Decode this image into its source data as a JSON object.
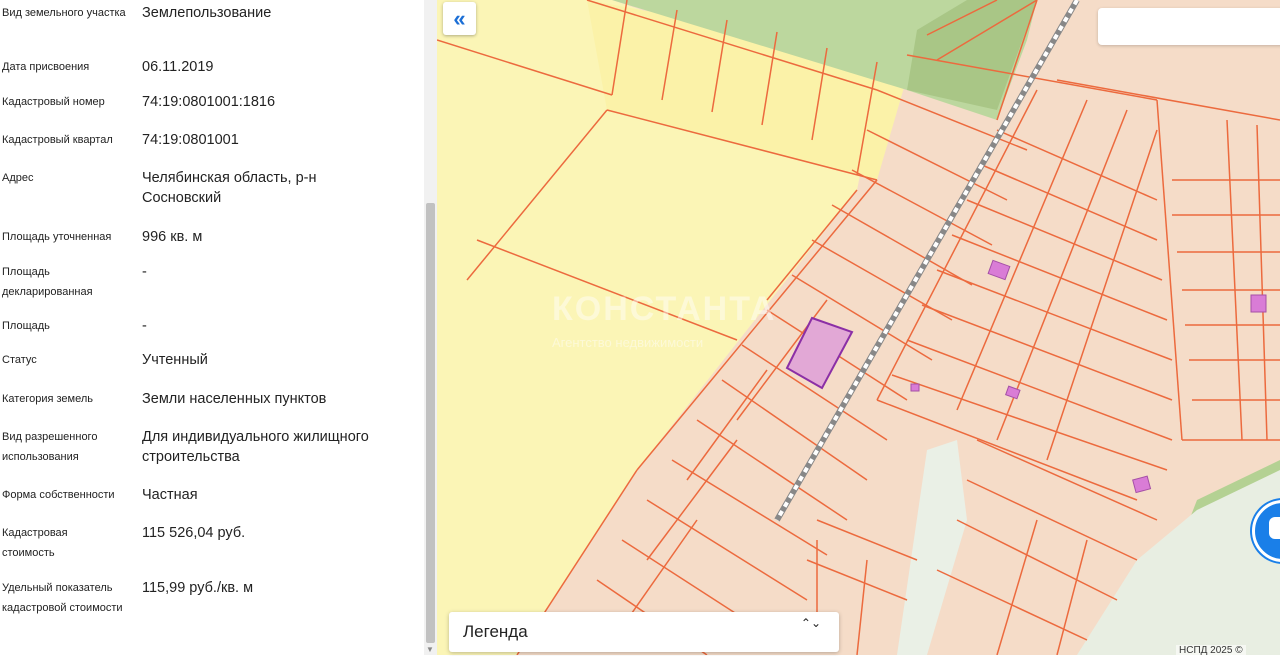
{
  "properties": [
    {
      "label": "Вид земельного участка",
      "value": "Землепользование"
    },
    {
      "label": "Дата присвоения",
      "value": "06.11.2019"
    },
    {
      "label": "Кадастровый номер",
      "value": "74:19:0801001:1816"
    },
    {
      "label": "Кадастровый квартал",
      "value": "74:19:0801001"
    },
    {
      "label": "Адрес",
      "value": "Челябинская область, р-н Сосновский"
    },
    {
      "label": "Площадь уточненная",
      "value": "996 кв. м"
    },
    {
      "label": "Площадь декларированная",
      "value": "-"
    },
    {
      "label": "Площадь",
      "value": "-"
    },
    {
      "label": "Статус",
      "value": "Учтенный"
    },
    {
      "label": "Категория земель",
      "value": "Земли населенных пунктов"
    },
    {
      "label": "Вид разрешенного использования",
      "value": "Для индивидуального жилищного строительства"
    },
    {
      "label": "Форма собственности",
      "value": "Частная"
    },
    {
      "label": "Кадастровая стоимость",
      "value": "115 526,04 руб."
    },
    {
      "label": "Удельный показатель кадастровой стоимости",
      "value": "115,99 руб./кв. м"
    }
  ],
  "map": {
    "collapse_icon": "«",
    "legend_label": "Легенда",
    "legend_arrows": "⌃⌄",
    "watermark": "КОНСТАНТА",
    "watermark_sub": "Агентство недвижимости",
    "attribution": "НСПД 2025 ©",
    "colors": {
      "background": "#f5dcc8",
      "parcel_line": "#ec6a3e",
      "yellow_zone": "#fbf5b6",
      "green_zone": "#a8c98a",
      "selected_parcel": "#8b2fa6",
      "building": "#d97cd6"
    }
  }
}
